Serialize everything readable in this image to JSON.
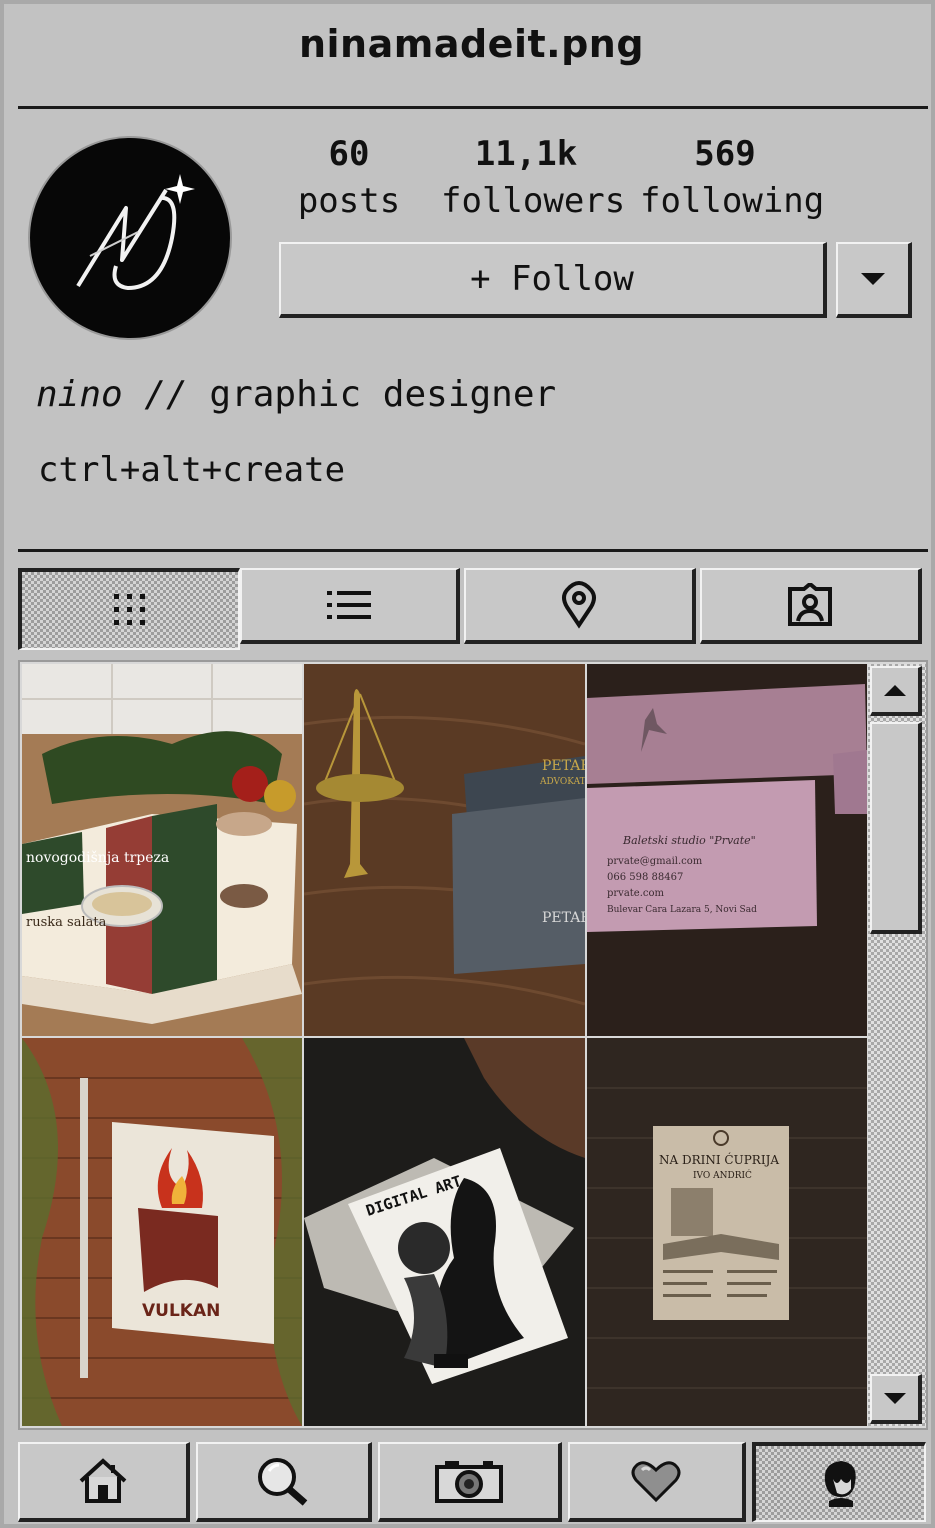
{
  "window": {
    "title": "ninamadeit.png"
  },
  "profile": {
    "stats": [
      {
        "value": "60",
        "label": "posts"
      },
      {
        "value": "11,1k",
        "label": "followers"
      },
      {
        "value": "569",
        "label": "following"
      }
    ],
    "follow_label": "+ Follow",
    "bio_name": "nino //",
    "bio_role": "graphic designer",
    "bio_tagline": "ctrl+alt+create"
  },
  "tabs": [
    {
      "icon": "grid-icon",
      "active": true
    },
    {
      "icon": "list-icon",
      "active": false
    },
    {
      "icon": "location-pin-icon",
      "active": false
    },
    {
      "icon": "tagged-user-icon",
      "active": false
    }
  ],
  "posts": [
    {
      "title": "novogodišnja trpeza",
      "subtitle": "ruska salata",
      "icon": "cookbook-mockup"
    },
    {
      "title": "PETAR",
      "subtitle": "ADVOKAT",
      "icon": "scales-business-card"
    },
    {
      "title": "Baletski studio \"Prvate\"",
      "lines": [
        "prvate@gmail.com",
        "066 598 88467",
        "prvate.com",
        "Bulevar Cara Lazara 5, Novi Sad"
      ],
      "icon": "ballet-business-card"
    },
    {
      "title": "VULKAN",
      "icon": "flame-sign"
    },
    {
      "title": "DIGITAL ART",
      "icon": "magazine-mockup"
    },
    {
      "title": "NA DRINI ĆUPRIJA",
      "subtitle": "IVO ANDRIĆ",
      "icon": "book-poster"
    }
  ],
  "bottom_nav": [
    {
      "icon": "home-icon"
    },
    {
      "icon": "search-icon"
    },
    {
      "icon": "camera-icon"
    },
    {
      "icon": "heart-icon"
    },
    {
      "icon": "profile-icon",
      "active": true
    }
  ],
  "colors": {
    "window_bg": "#c2c2c2",
    "rule": "#1a1a1a",
    "accent_red": "#8b2a22"
  }
}
